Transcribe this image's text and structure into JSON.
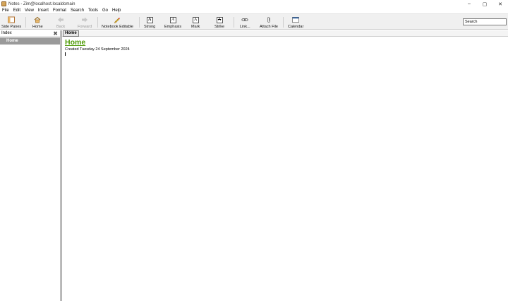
{
  "window": {
    "title": "Notes - Zim@localhost.localdomain",
    "minimize": "–",
    "maximize": "▢",
    "close": "✕"
  },
  "menu": [
    "File",
    "Edit",
    "View",
    "Insert",
    "Format",
    "Search",
    "Tools",
    "Go",
    "Help"
  ],
  "toolbar": {
    "side_panes": "Side Panes",
    "home": "Home",
    "back": "Back",
    "forward": "Forward",
    "notebook_editable": "Notebook Editable",
    "strong": "Strong",
    "emphasis": "Emphasis",
    "mark": "Mark",
    "strike": "Strike",
    "link": "Link...",
    "attach_file": "Attach File",
    "calendar": "Calendar",
    "search_value": "Search",
    "strong_glyph": "A",
    "emphasis_glyph": "A",
    "mark_glyph": "A",
    "strike_glyph": "A"
  },
  "sidepane": {
    "header": "Index",
    "items": [
      "Home"
    ]
  },
  "pathbar": {
    "current": "Home"
  },
  "page": {
    "heading": "Home",
    "created": "Created Tuesday 24 September 2024"
  },
  "colors": {
    "heading_green": "#4e9a06",
    "selected_row": "#9a9a9a"
  }
}
